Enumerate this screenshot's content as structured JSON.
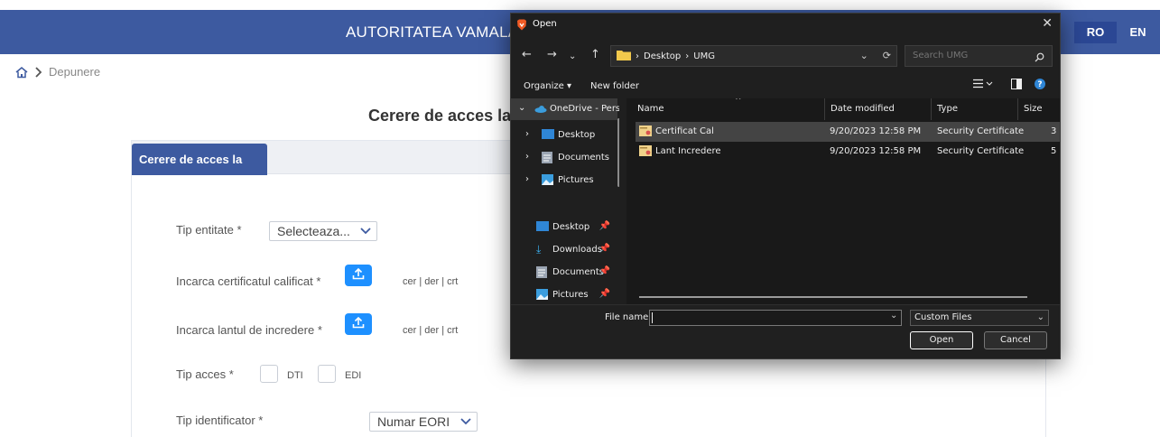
{
  "header": {
    "title": "AUTORITATEA VAMALA",
    "languages": [
      "RO",
      "EN"
    ],
    "active_language": "RO"
  },
  "breadcrumb": {
    "current": "Depunere"
  },
  "page": {
    "heading": "Cerere de acces la"
  },
  "tab": {
    "label": "Cerere de acces la SIIV"
  },
  "form": {
    "tip_entitate": {
      "label": "Tip entitate *",
      "value": "Selecteaza..."
    },
    "certificat": {
      "label": "Incarca certificatul calificat *",
      "extensions": "cer | der | crt"
    },
    "lant": {
      "label": "Incarca lantul de incredere *",
      "extensions": "cer | der | crt"
    },
    "tip_acces": {
      "label": "Tip acces *",
      "options": [
        "DTI",
        "EDI"
      ]
    },
    "tip_identificator": {
      "label": "Tip identificator *",
      "value": "Numar EORI"
    }
  },
  "dialog": {
    "title": "Open",
    "path": [
      "Desktop",
      "UMG"
    ],
    "search_placeholder": "Search UMG",
    "toolbar": {
      "organize": "Organize ▾",
      "new_folder": "New folder"
    },
    "tree": {
      "onedrive": "OneDrive - Pers",
      "top_items": [
        "Desktop",
        "Documents",
        "Pictures"
      ],
      "quick_access": [
        "Desktop",
        "Downloads",
        "Documents",
        "Pictures"
      ]
    },
    "columns": [
      "Name",
      "Date modified",
      "Type",
      "Size"
    ],
    "files": [
      {
        "name": "Certificat Cal",
        "date": "9/20/2023 12:58 PM",
        "type": "Security Certificate",
        "size": "3"
      },
      {
        "name": "Lant Incredere",
        "date": "9/20/2023 12:58 PM",
        "type": "Security Certificate",
        "size": "5"
      }
    ],
    "file_name_label": "File name:",
    "file_name_value": "",
    "file_type": "Custom Files",
    "open_label": "Open",
    "cancel_label": "Cancel"
  }
}
